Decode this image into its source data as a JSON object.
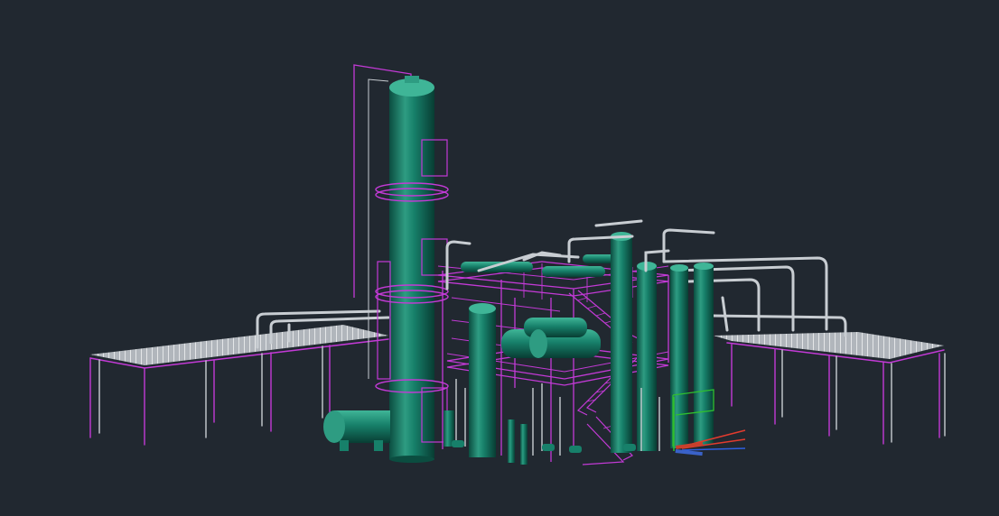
{
  "viewport": {
    "background": "#212830"
  },
  "colors": {
    "vessel": "#17806a",
    "vessel_light": "#3fb597",
    "vessel_dark": "#0b4d40",
    "steel": "#c33ad6",
    "pipe": "#c8cdd2",
    "pipe_dark": "#8f969c",
    "axis_x": "#e23b2e",
    "axis_y": "#2fbf2f",
    "axis_z": "#2f5fe0"
  },
  "icons": {
    "ucs": "ucs-axis-icon"
  }
}
